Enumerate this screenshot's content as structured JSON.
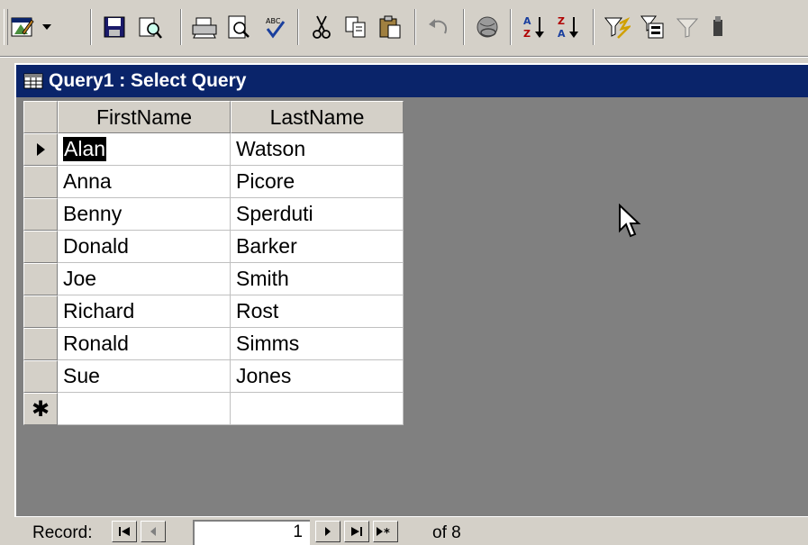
{
  "window": {
    "title": "Query1 : Select Query"
  },
  "toolbar": {
    "buttons": [
      "view-icon",
      "dropdown-arrow-icon",
      "save-icon",
      "search-icon",
      "print-icon",
      "print-preview-icon",
      "spelling-icon",
      "cut-icon",
      "copy-icon",
      "paste-icon",
      "undo-icon",
      "hyperlink-icon",
      "sort-ascending-icon",
      "sort-descending-icon",
      "filter-by-selection-icon",
      "filter-by-form-icon",
      "apply-filter-icon",
      "find-icon"
    ]
  },
  "grid": {
    "columns": [
      "FirstName",
      "LastName"
    ],
    "rows": [
      {
        "first": "Alan",
        "last": "Watson",
        "current": true
      },
      {
        "first": "Anna",
        "last": "Picore"
      },
      {
        "first": "Benny",
        "last": "Sperduti"
      },
      {
        "first": "Donald",
        "last": "Barker"
      },
      {
        "first": "Joe",
        "last": "Smith"
      },
      {
        "first": "Richard",
        "last": "Rost"
      },
      {
        "first": "Ronald",
        "last": "Simms"
      },
      {
        "first": "Sue",
        "last": "Jones"
      }
    ],
    "new_row_marker": "✱"
  },
  "navigator": {
    "label": "Record:",
    "current": "1",
    "total_label": "of 8"
  }
}
